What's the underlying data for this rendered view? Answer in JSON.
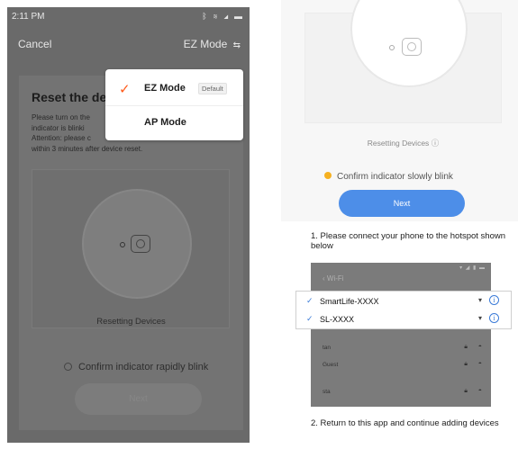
{
  "left_screen": {
    "status": {
      "time": "2:11 PM",
      "icons": "ᛒ ≋ ◢ ▬"
    },
    "nav": {
      "cancel_label": "Cancel",
      "mode_label": "EZ Mode",
      "mode_arrow": "⇆"
    },
    "card": {
      "title": "Reset the de",
      "desc_lines": [
        "Please turn on the",
        "indicator is blinki",
        "Attention: please c",
        "within 3 minutes after device reset."
      ],
      "resetting_label": "Resetting Devices",
      "confirm_label": "Confirm indicator rapidly blink",
      "next_label": "Next"
    },
    "mode_menu": {
      "items": [
        {
          "label": "EZ Mode",
          "badge": "Default",
          "selected": true
        },
        {
          "label": "AP Mode",
          "badge": "",
          "selected": false
        }
      ],
      "check_color": "#ff5a1a"
    }
  },
  "right_screen": {
    "resetting_label": "Resetting Devices",
    "info_glyph": "ⓘ",
    "confirm_label": "Confirm indicator slowly blink",
    "next_label": "Next",
    "accent_color": "#4d8ee8"
  },
  "instructions": {
    "step1": "1. Please connect your phone to the hotspot shown below",
    "step2": "2. Return to this app and continue adding devices"
  },
  "wifi_screen": {
    "title": "Wi-Fi",
    "popout_networks": [
      {
        "name": "SmartLife-XXXX"
      },
      {
        "name": "SL-XXXX"
      }
    ],
    "networks": [
      {
        "name": "tan"
      },
      {
        "name": "Guest"
      },
      {
        "name": "sta"
      }
    ]
  }
}
